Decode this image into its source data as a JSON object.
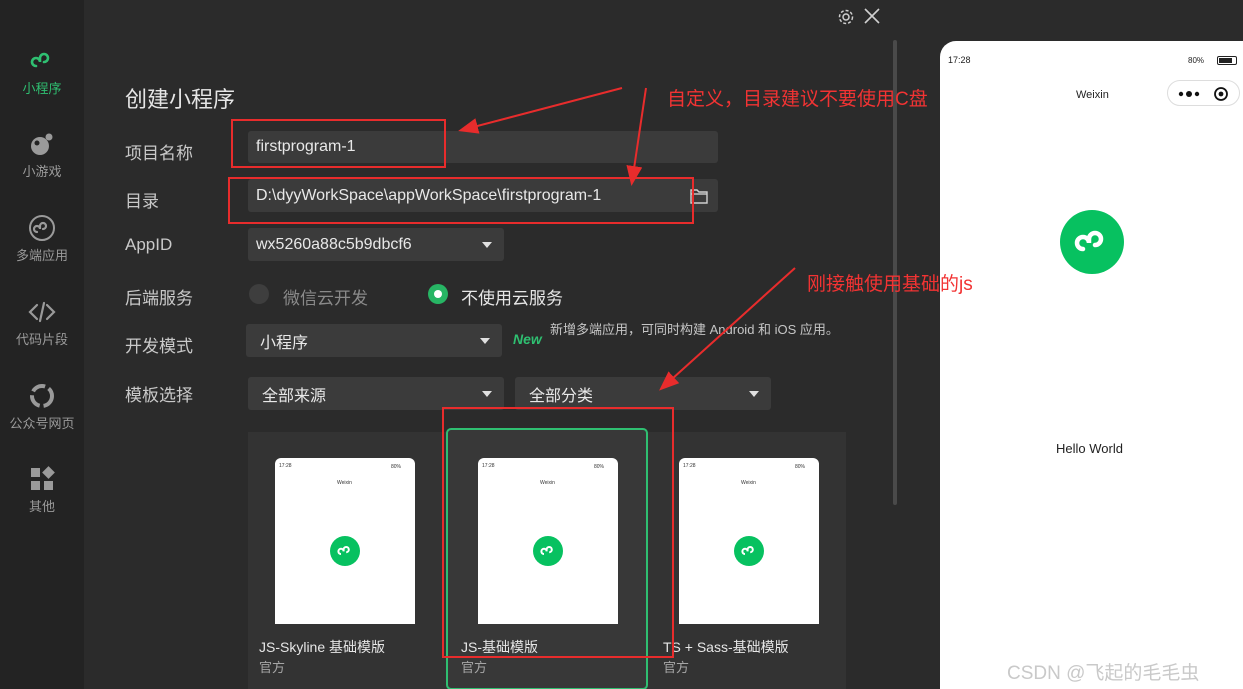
{
  "sidebar": {
    "items": [
      {
        "label": "小程序",
        "icon": "miniprogram-icon",
        "active": true
      },
      {
        "label": "小游戏",
        "icon": "minigame-icon",
        "active": false
      },
      {
        "label": "多端应用",
        "icon": "multiplatform-icon",
        "active": false
      },
      {
        "label": "代码片段",
        "icon": "code-icon",
        "active": false
      },
      {
        "label": "公众号网页",
        "icon": "official-account-icon",
        "active": false
      },
      {
        "label": "其他",
        "icon": "grid-icon",
        "active": false
      }
    ]
  },
  "header": {
    "settings_icon": "gear-icon",
    "close_icon": "close-icon"
  },
  "form": {
    "title": "创建小程序",
    "name_label": "项目名称",
    "name_value": "firstprogram-1",
    "dir_label": "目录",
    "dir_value": "D:\\dyyWorkSpace\\appWorkSpace\\firstprogram-1",
    "appid_label": "AppID",
    "appid_value": "wx5260a88c5b9dbcf6",
    "backend_label": "后端服务",
    "backend_option_cloud": "微信云开发",
    "backend_option_none": "不使用云服务",
    "backend_selected": "不使用云服务",
    "mode_label": "开发模式",
    "mode_value": "小程序",
    "new_tag": "New",
    "mode_hint": "新增多端应用，可同时构建 Android 和 iOS 应用。",
    "template_label": "模板选择",
    "template_source": "全部来源",
    "template_category": "全部分类"
  },
  "templates": [
    {
      "name": "JS-Skyline 基础模版",
      "source": "官方",
      "selected": false
    },
    {
      "name": "JS-基础模版",
      "source": "官方",
      "selected": true
    },
    {
      "name": "TS + Sass-基础模版",
      "source": "官方",
      "selected": false
    }
  ],
  "thumb": {
    "time": "17:28",
    "battery": "80%",
    "title": "Weixin"
  },
  "preview": {
    "time": "17:28",
    "battery": "80%",
    "nav_title": "Weixin",
    "body_text": "Hello World"
  },
  "annotations": {
    "note_top": "自定义，目录建议不要使用C盘",
    "note_mid": "刚接触使用基础的js"
  },
  "watermark": "CSDN @飞起的毛毛虫",
  "colors": {
    "accent": "#2fbf71",
    "annotation": "#e82c2c"
  }
}
